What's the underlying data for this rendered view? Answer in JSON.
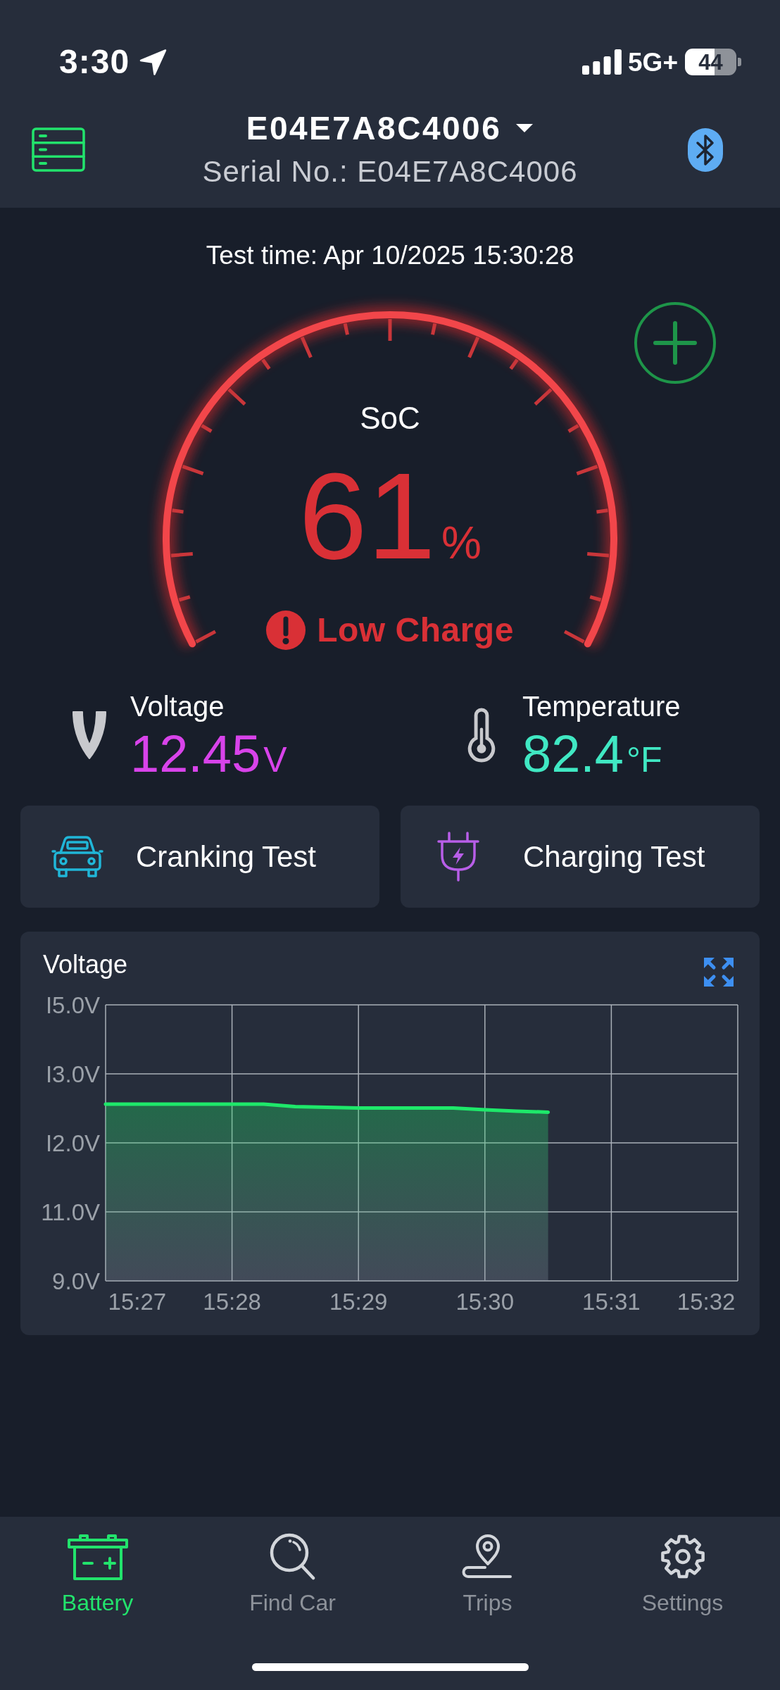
{
  "status_bar": {
    "time": "3:30",
    "network": "5G+",
    "battery": "44"
  },
  "header": {
    "title": "E04E7A8C4006",
    "subtitle": "Serial No.: E04E7A8C4006"
  },
  "test_time": "Test time: Apr 10/2025 15:30:28",
  "gauge": {
    "label": "SoC",
    "value": "61",
    "unit": "%",
    "status": "Low Charge",
    "alert": true
  },
  "readings": [
    {
      "kind": "voltage",
      "label": "Voltage",
      "value": "12.45",
      "unit": "V"
    },
    {
      "kind": "temperature",
      "label": "Temperature",
      "value": "82.4",
      "unit": "°F"
    }
  ],
  "actions": [
    {
      "kind": "cranking",
      "label": "Cranking Test"
    },
    {
      "kind": "charging",
      "label": "Charging Test"
    }
  ],
  "chart_card": {
    "chart_data": {
      "type": "area",
      "title": "Voltage",
      "grid": true,
      "categories": [
        null,
        "15:27",
        null,
        null,
        "15:28",
        null,
        null,
        null,
        "15:29",
        null,
        null,
        null,
        "15:30",
        null,
        null,
        null,
        "15:31",
        null,
        null,
        "15:32",
        null
      ],
      "series": [
        {
          "color": "#1ee86a",
          "values": [
            14.12,
            14.12,
            14.12,
            14.12,
            14.12,
            14.12,
            14.05,
            14.03,
            14.01,
            14.01,
            14.01,
            14.01,
            13.96,
            13.92,
            13.89,
            null,
            null,
            null,
            null,
            null,
            null
          ]
        }
      ],
      "ylim": [
        9,
        17
      ],
      "yticks": [
        {
          "value": 9,
          "label": "9.0V"
        },
        {
          "value": 11,
          "label": "11.0V"
        },
        {
          "value": 13,
          "label": "I2.0V"
        },
        {
          "value": 15,
          "label": "I3.0V"
        },
        {
          "value": 17,
          "label": "I5.0V"
        }
      ]
    }
  },
  "tab_bar": [
    {
      "kind": "battery",
      "label": "Battery",
      "selected": true
    },
    {
      "kind": "find_car",
      "label": "Find Car",
      "selected": false
    },
    {
      "kind": "trips",
      "label": "Trips",
      "selected": false
    },
    {
      "kind": "settings",
      "label": "Settings",
      "selected": false
    }
  ]
}
